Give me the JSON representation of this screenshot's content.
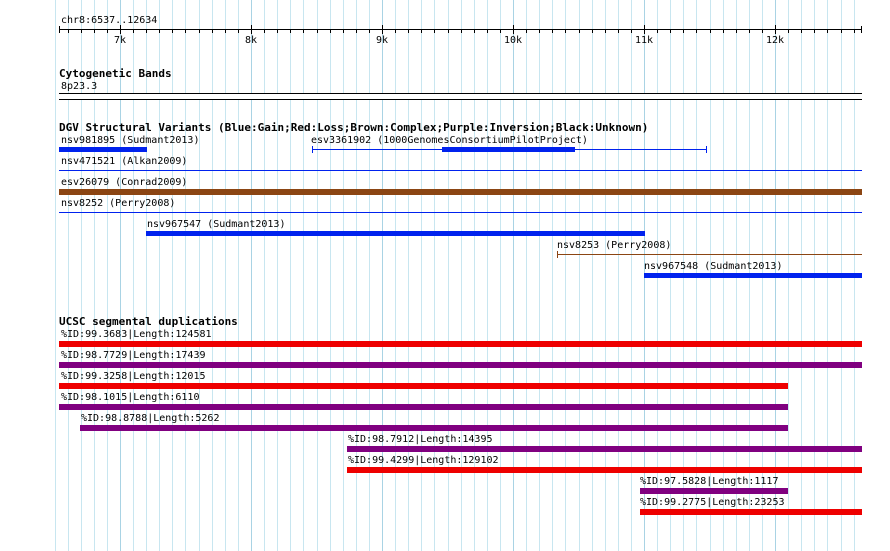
{
  "ruler": {
    "position": "chr8:6537..12634",
    "ticks": [
      "7k",
      "8k",
      "9k",
      "10k",
      "11k",
      "12k"
    ]
  },
  "cytobands": {
    "title": "Cytogenetic Bands",
    "band": "8p23.3"
  },
  "dgv": {
    "title": "DGV Structural Variants (Blue:Gain;Red:Loss;Brown:Complex;Purple:Inversion;Black:Unknown)",
    "features": [
      {
        "label": "nsv981895 (Sudmant2013)",
        "color": "#0022ee",
        "kind": "gain"
      },
      {
        "label": "esv3361902 (1000GenomesConsortiumPilotProject)",
        "color": "#0022ee",
        "kind": "gain"
      },
      {
        "label": "nsv471521 (Alkan2009)",
        "color": "#0022ee",
        "kind": "gain"
      },
      {
        "label": "esv26079 (Conrad2009)",
        "color": "#8b4513",
        "kind": "complex"
      },
      {
        "label": "nsv8252 (Perry2008)",
        "color": "#0022ee",
        "kind": "gain"
      },
      {
        "label": "nsv967547 (Sudmant2013)",
        "color": "#0022ee",
        "kind": "gain"
      },
      {
        "label": "nsv8253 (Perry2008)",
        "color": "#8b4513",
        "kind": "complex"
      },
      {
        "label": "nsv967548 (Sudmant2013)",
        "color": "#0022ee",
        "kind": "gain"
      }
    ]
  },
  "segdups": {
    "title": "UCSC segmental duplications",
    "features": [
      {
        "label": "%ID:99.3683|Length:124581",
        "color": "#ee0000"
      },
      {
        "label": "%ID:98.7729|Length:17439",
        "color": "#800080"
      },
      {
        "label": "%ID:99.3258|Length:12015",
        "color": "#ee0000"
      },
      {
        "label": "%ID:98.1015|Length:6110",
        "color": "#800080"
      },
      {
        "label": "%ID:98.8788|Length:5262",
        "color": "#800080"
      },
      {
        "label": "%ID:98.7912|Length:14395",
        "color": "#800080"
      },
      {
        "label": "%ID:99.4299|Length:129102",
        "color": "#ee0000"
      },
      {
        "label": "%ID:97.5828|Length:1117",
        "color": "#800080"
      },
      {
        "label": "%ID:99.2775|Length:23253",
        "color": "#ee0000"
      }
    ]
  }
}
